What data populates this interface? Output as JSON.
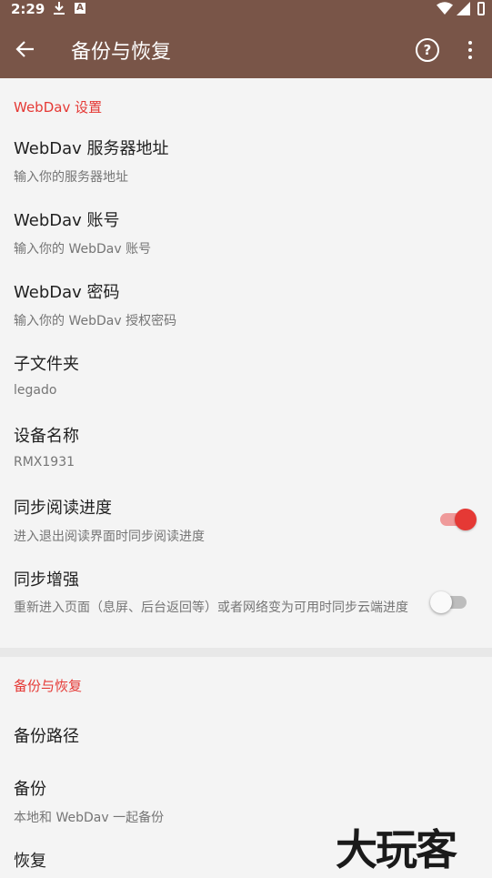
{
  "status_bar": {
    "time": "2:29",
    "icons": [
      "download-icon",
      "a-icon",
      "wifi-icon",
      "signal-icon",
      "battery-icon"
    ]
  },
  "app_bar": {
    "title": "备份与恢复",
    "back_icon": "arrow-left-icon",
    "help_icon": "help-icon",
    "menu_icon": "more-vert-icon",
    "color": "#795548"
  },
  "sections": {
    "webdav": {
      "header": "WebDav 设置",
      "items": [
        {
          "title": "WebDav 服务器地址",
          "summary": "输入你的服务器地址"
        },
        {
          "title": "WebDav 账号",
          "summary": "输入你的 WebDav 账号"
        },
        {
          "title": "WebDav 密码",
          "summary": "输入你的 WebDav 授权密码"
        },
        {
          "title": "子文件夹",
          "summary": "legado"
        },
        {
          "title": "设备名称",
          "summary": "RMX1931"
        },
        {
          "title": "同步阅读进度",
          "summary": "进入退出阅读界面时同步阅读进度",
          "switch": true
        },
        {
          "title": "同步增强",
          "summary": "重新进入页面（息屏、后台返回等）或者网络变为可用时同步云端进度",
          "switch": false
        }
      ]
    },
    "backup": {
      "header": "备份与恢复",
      "items": [
        {
          "title": "备份路径"
        },
        {
          "title": "备份",
          "summary": "本地和 WebDav 一起备份"
        },
        {
          "title": "恢复"
        }
      ]
    }
  },
  "colors": {
    "accent": "#e53935",
    "switch_on_track": "#ef9a9a",
    "background": "#f4f4f4"
  },
  "watermark": "大玩客"
}
